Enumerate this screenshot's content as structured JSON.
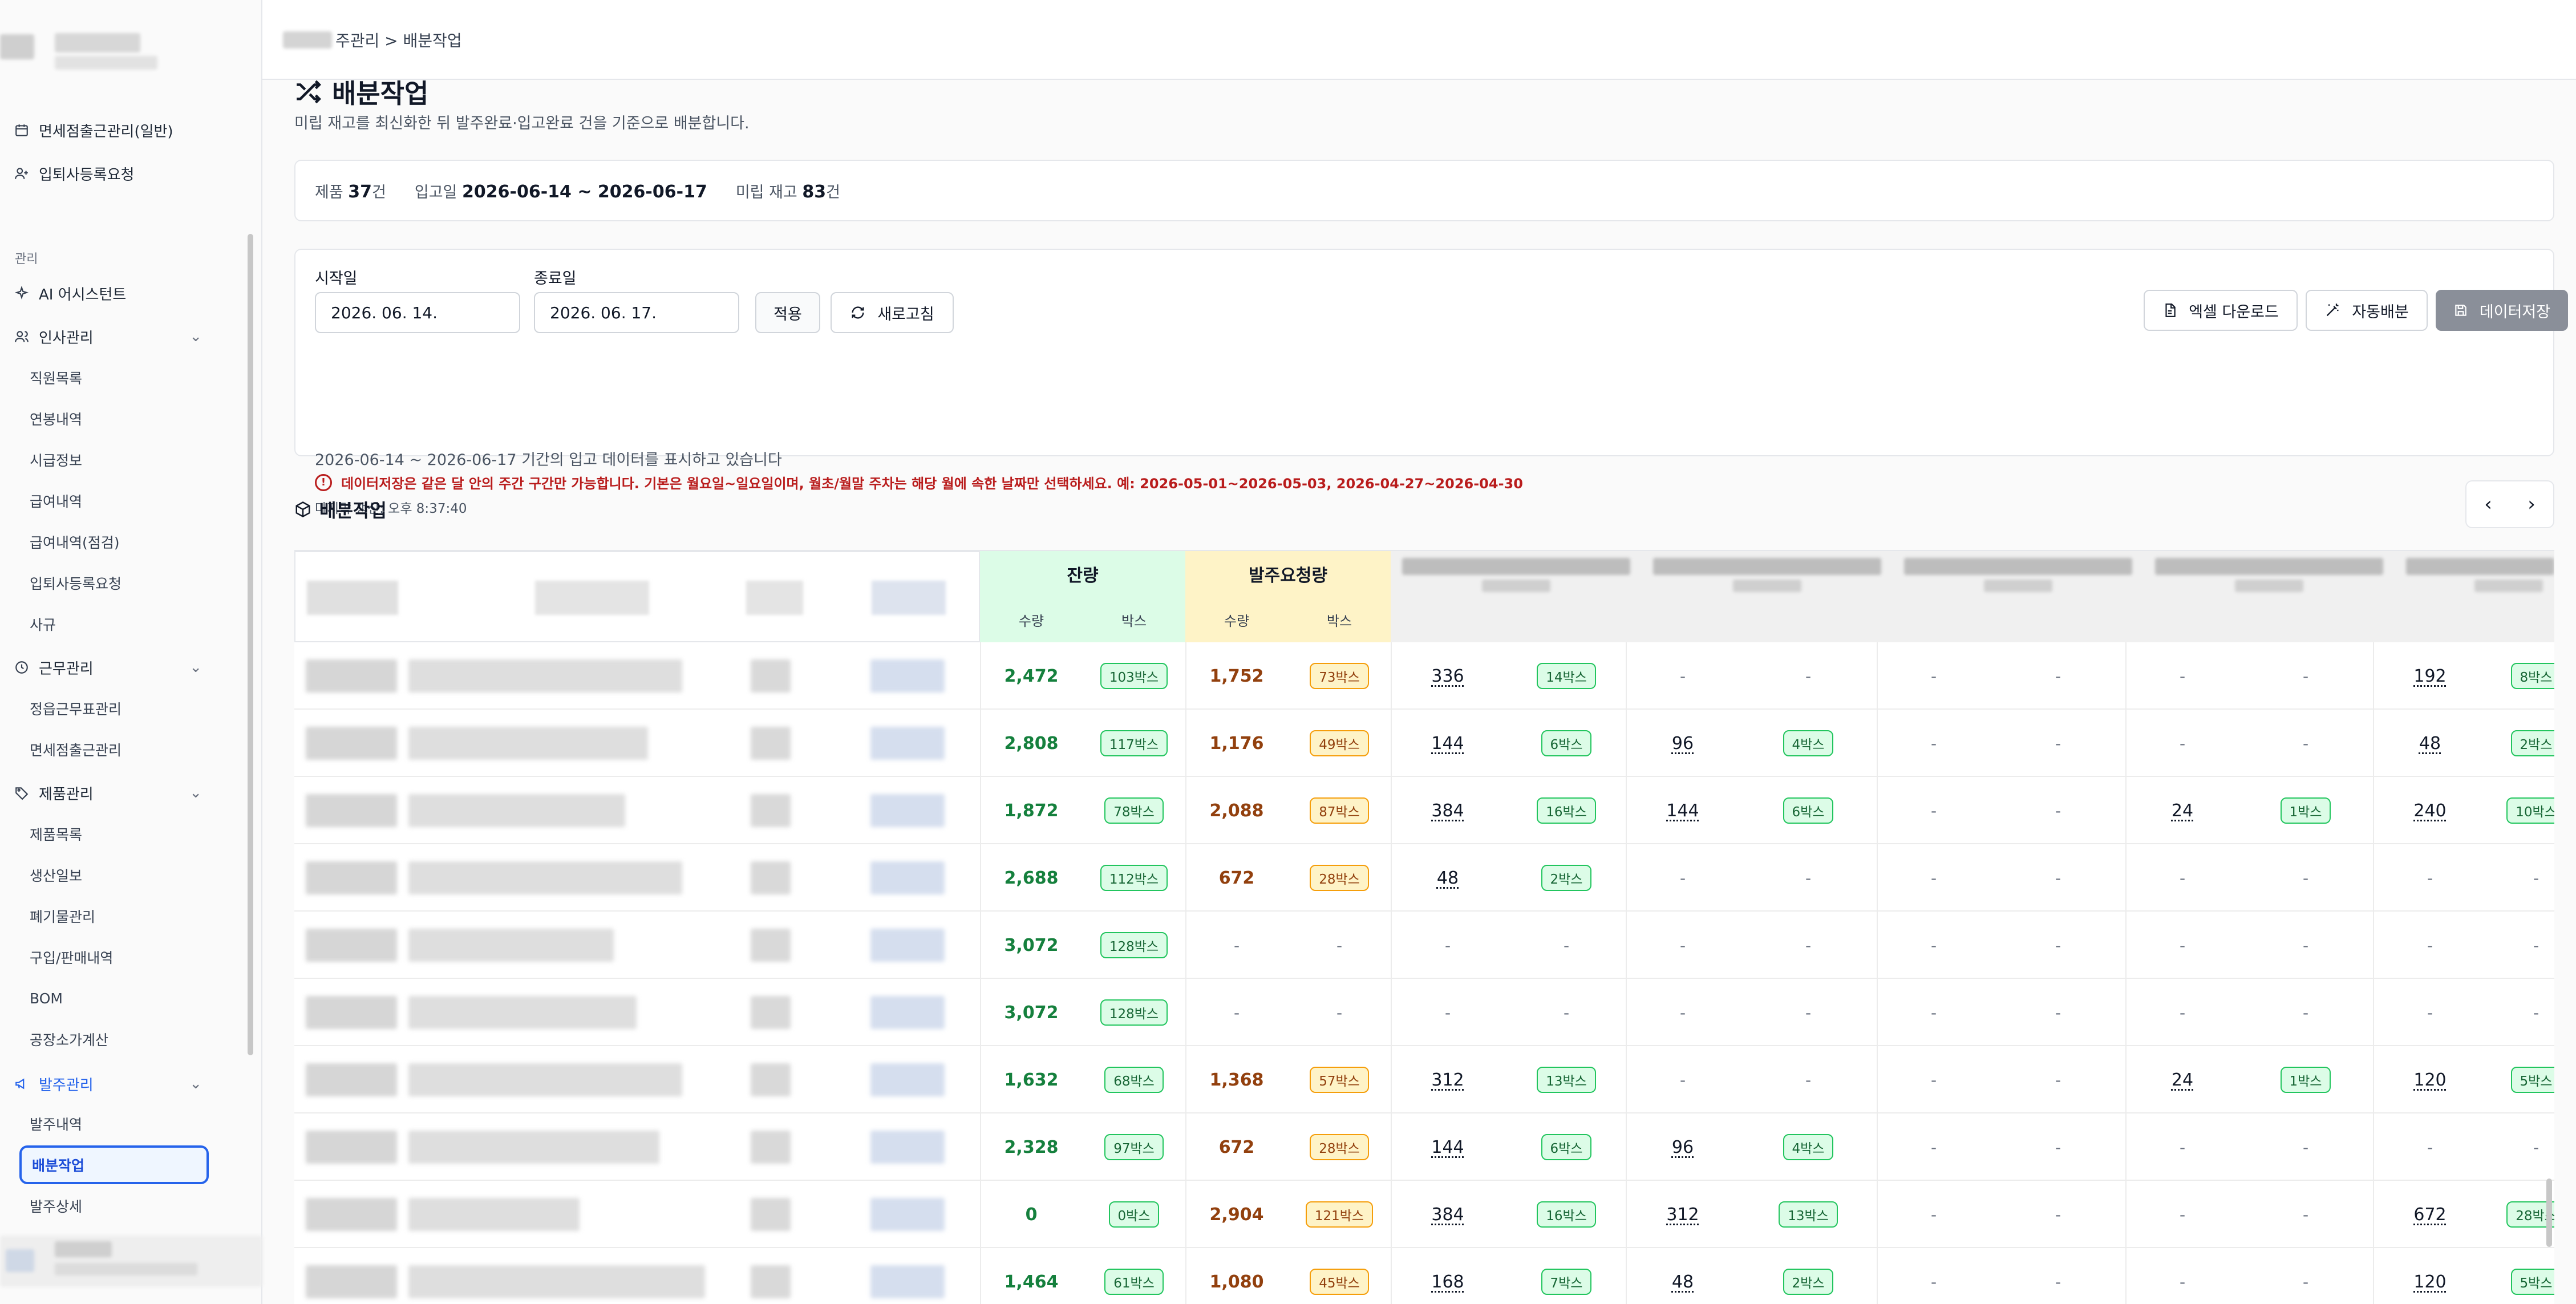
{
  "breadcrumb": {
    "current_tail": "주관리 > 배분작업"
  },
  "sidebar": {
    "top_items": [
      {
        "label": "면세점출근관리(일반)",
        "icon": "calendar-icon"
      },
      {
        "label": "입퇴사등록요청",
        "icon": "user-add-icon"
      }
    ],
    "section_label": "관리",
    "groups": [
      {
        "label": "AI 어시스턴트",
        "icon": "sparkle-icon"
      },
      {
        "label": "인사관리",
        "icon": "users-icon",
        "items": [
          "직원목록",
          "연봉내역",
          "시급정보",
          "급여내역",
          "급여내역(점검)",
          "입퇴사등록요청",
          "사규"
        ]
      },
      {
        "label": "근무관리",
        "icon": "clock-icon",
        "items": [
          "정읍근무표관리",
          "면세점출근관리"
        ]
      },
      {
        "label": "제품관리",
        "icon": "tag-icon",
        "items": [
          "제품목록",
          "생산일보",
          "폐기물관리",
          "구입/판매내역",
          "BOM",
          "공장소가계산"
        ]
      },
      {
        "label": "발주관리",
        "icon": "megaphone-icon",
        "items": [
          "발주내역",
          "배분작업",
          "발주상세"
        ]
      }
    ],
    "active_item": "배분작업"
  },
  "page": {
    "title": "배분작업",
    "description": "미립 재고를 최신화한 뒤 발주완료·입고완료 건을 기준으로 배분합니다."
  },
  "summary": {
    "product_label": "제품",
    "product_count": "37",
    "product_unit": "건",
    "date_label": "입고일",
    "date_range": "2026-06-14 ~ 2026-06-17",
    "stock_label": "미립 재고",
    "stock_count": "83",
    "stock_unit": "건"
  },
  "filter": {
    "start_label": "시작일",
    "start_value": "2026. 06. 14.",
    "end_label": "종료일",
    "end_value": "2026. 06. 17.",
    "apply_label": "적용",
    "refresh_label": "새로고침",
    "excel_label": "엑셀 다운로드",
    "auto_label": "자동배분",
    "save_label": "데이터저장",
    "info_line": "2026-06-14 ~ 2026-06-17 기간의 입고 데이터를 표시하고 있습니다",
    "warning_line": "데이터저장은 같은 달 안의 주간 구간만 가능합니다. 기본은 월요일~일요일이며, 월초/월말 주차는 해당 월에 속한 날짜만 선택하세요. 예: 2026-05-01~2026-05-03, 2026-04-27~2026-04-30",
    "last_updated": "마지막 갱신: 오후 8:37:40"
  },
  "section": {
    "title": "배분작업",
    "prev": "‹",
    "next": "›"
  },
  "table": {
    "remain_header": "잔량",
    "order_header": "발주요청량",
    "qty_label": "수량",
    "box_label": "박스",
    "rows": [
      {
        "remain_qty": "2,472",
        "remain_box": "103박스",
        "order_qty": "1,752",
        "order_box": "73박스",
        "s": [
          [
            "336",
            "14박스"
          ],
          [
            "-",
            "-"
          ],
          [
            "-",
            "-"
          ],
          [
            "-",
            "-"
          ],
          [
            "192",
            "8박스"
          ]
        ]
      },
      {
        "remain_qty": "2,808",
        "remain_box": "117박스",
        "order_qty": "1,176",
        "order_box": "49박스",
        "s": [
          [
            "144",
            "6박스"
          ],
          [
            "96",
            "4박스"
          ],
          [
            "-",
            "-"
          ],
          [
            "-",
            "-"
          ],
          [
            "48",
            "2박스"
          ]
        ]
      },
      {
        "remain_qty": "1,872",
        "remain_box": "78박스",
        "order_qty": "2,088",
        "order_box": "87박스",
        "s": [
          [
            "384",
            "16박스"
          ],
          [
            "144",
            "6박스"
          ],
          [
            "-",
            "-"
          ],
          [
            "24",
            "1박스"
          ],
          [
            "240",
            "10박스"
          ]
        ]
      },
      {
        "remain_qty": "2,688",
        "remain_box": "112박스",
        "order_qty": "672",
        "order_box": "28박스",
        "s": [
          [
            "48",
            "2박스"
          ],
          [
            "-",
            "-"
          ],
          [
            "-",
            "-"
          ],
          [
            "-",
            "-"
          ],
          [
            "-",
            "-"
          ]
        ]
      },
      {
        "remain_qty": "3,072",
        "remain_box": "128박스",
        "order_qty": "-",
        "order_box": "-",
        "s": [
          [
            "-",
            "-"
          ],
          [
            "-",
            "-"
          ],
          [
            "-",
            "-"
          ],
          [
            "-",
            "-"
          ],
          [
            "-",
            "-"
          ]
        ]
      },
      {
        "remain_qty": "3,072",
        "remain_box": "128박스",
        "order_qty": "-",
        "order_box": "-",
        "s": [
          [
            "-",
            "-"
          ],
          [
            "-",
            "-"
          ],
          [
            "-",
            "-"
          ],
          [
            "-",
            "-"
          ],
          [
            "-",
            "-"
          ]
        ]
      },
      {
        "remain_qty": "1,632",
        "remain_box": "68박스",
        "order_qty": "1,368",
        "order_box": "57박스",
        "s": [
          [
            "312",
            "13박스"
          ],
          [
            "-",
            "-"
          ],
          [
            "-",
            "-"
          ],
          [
            "24",
            "1박스"
          ],
          [
            "120",
            "5박스"
          ]
        ]
      },
      {
        "remain_qty": "2,328",
        "remain_box": "97박스",
        "order_qty": "672",
        "order_box": "28박스",
        "s": [
          [
            "144",
            "6박스"
          ],
          [
            "96",
            "4박스"
          ],
          [
            "-",
            "-"
          ],
          [
            "-",
            "-"
          ],
          [
            "-",
            "-"
          ]
        ]
      },
      {
        "remain_qty": "0",
        "remain_box": "0박스",
        "order_qty": "2,904",
        "order_box": "121박스",
        "s": [
          [
            "384",
            "16박스"
          ],
          [
            "312",
            "13박스"
          ],
          [
            "-",
            "-"
          ],
          [
            "-",
            "-"
          ],
          [
            "672",
            "28박스"
          ]
        ]
      },
      {
        "remain_qty": "1,464",
        "remain_box": "61박스",
        "order_qty": "1,080",
        "order_box": "45박스",
        "s": [
          [
            "168",
            "7박스"
          ],
          [
            "48",
            "2박스"
          ],
          [
            "-",
            "-"
          ],
          [
            "-",
            "-"
          ],
          [
            "120",
            "5박스"
          ]
        ]
      }
    ]
  }
}
